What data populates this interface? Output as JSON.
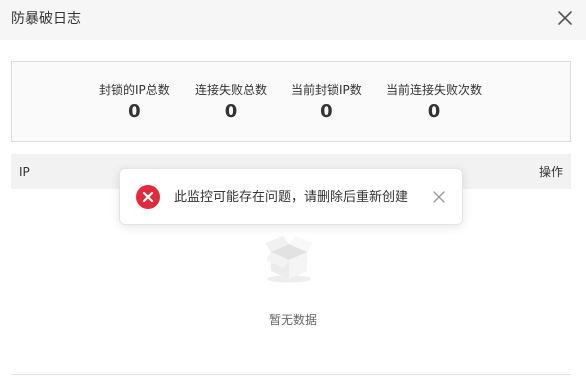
{
  "dialog": {
    "title": "防暴破日志",
    "close_icon": "close-icon"
  },
  "stats": [
    {
      "label": "封锁的IP总数",
      "value": "0"
    },
    {
      "label": "连接失败总数",
      "value": "0"
    },
    {
      "label": "当前封锁IP数",
      "value": "0"
    },
    {
      "label": "当前连接失败次数",
      "value": "0"
    }
  ],
  "table": {
    "columns": {
      "ip": "IP",
      "operation": "操作"
    },
    "empty_text": "暂无数据",
    "empty_icon": "empty-box-icon"
  },
  "toast": {
    "type": "error",
    "icon": "error-circle-icon",
    "message": "此监控可能存在问题，请删除后重新创建",
    "close_icon": "close-icon",
    "color": "#e02b3c"
  },
  "colors": {
    "header_bg": "#f6f6f6",
    "stats_bg": "#fafafa",
    "table_head_bg": "#f2f2f2",
    "error": "#e02b3c"
  }
}
